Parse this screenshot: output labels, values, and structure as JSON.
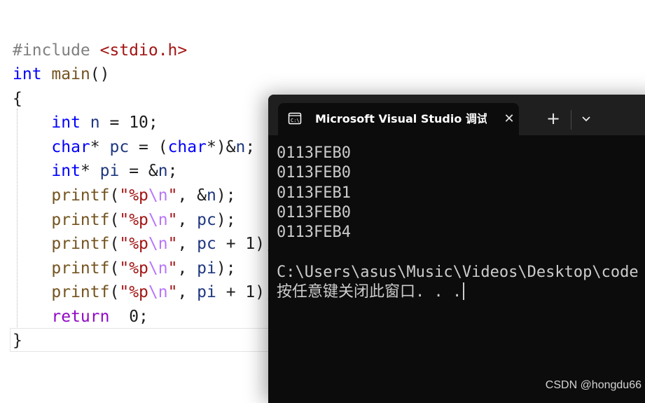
{
  "editor": {
    "lines": [
      {
        "tokens": [
          [
            "pre",
            "#include "
          ],
          [
            "inc",
            "<stdio.h>"
          ]
        ]
      },
      {
        "tokens": [
          [
            "kw",
            "int"
          ],
          [
            "op",
            " "
          ],
          [
            "fn",
            "main"
          ],
          [
            "op",
            "()"
          ]
        ]
      },
      {
        "tokens": [
          [
            "op",
            "{"
          ]
        ]
      },
      {
        "tokens": [
          [
            "op",
            "    "
          ],
          [
            "kw",
            "int"
          ],
          [
            "op",
            " "
          ],
          [
            "var",
            "n"
          ],
          [
            "op",
            " = "
          ],
          [
            "num",
            "10"
          ],
          [
            "op",
            ";"
          ]
        ]
      },
      {
        "tokens": [
          [
            "op",
            "    "
          ],
          [
            "kw",
            "char"
          ],
          [
            "op",
            "* "
          ],
          [
            "var",
            "pc"
          ],
          [
            "op",
            " = ("
          ],
          [
            "kw",
            "char"
          ],
          [
            "op",
            "*)&"
          ],
          [
            "var",
            "n"
          ],
          [
            "op",
            ";"
          ]
        ]
      },
      {
        "tokens": [
          [
            "op",
            "    "
          ],
          [
            "kw",
            "int"
          ],
          [
            "op",
            "* "
          ],
          [
            "var",
            "pi"
          ],
          [
            "op",
            " = &"
          ],
          [
            "var",
            "n"
          ],
          [
            "op",
            ";"
          ]
        ]
      },
      {
        "tokens": [
          [
            "op",
            "    "
          ],
          [
            "fn",
            "printf"
          ],
          [
            "op",
            "("
          ],
          [
            "str",
            "\"%p"
          ],
          [
            "esc",
            "\\n"
          ],
          [
            "str",
            "\""
          ],
          [
            "op",
            ", &"
          ],
          [
            "var",
            "n"
          ],
          [
            "op",
            ");"
          ]
        ]
      },
      {
        "tokens": [
          [
            "op",
            "    "
          ],
          [
            "fn",
            "printf"
          ],
          [
            "op",
            "("
          ],
          [
            "str",
            "\"%p"
          ],
          [
            "esc",
            "\\n"
          ],
          [
            "str",
            "\""
          ],
          [
            "op",
            ", "
          ],
          [
            "var",
            "pc"
          ],
          [
            "op",
            ");"
          ]
        ]
      },
      {
        "tokens": [
          [
            "op",
            "    "
          ],
          [
            "fn",
            "printf"
          ],
          [
            "op",
            "("
          ],
          [
            "str",
            "\"%p"
          ],
          [
            "esc",
            "\\n"
          ],
          [
            "str",
            "\""
          ],
          [
            "op",
            ", "
          ],
          [
            "var",
            "pc"
          ],
          [
            "op",
            " + "
          ],
          [
            "num",
            "1"
          ],
          [
            "op",
            ");"
          ]
        ]
      },
      {
        "tokens": [
          [
            "op",
            "    "
          ],
          [
            "fn",
            "printf"
          ],
          [
            "op",
            "("
          ],
          [
            "str",
            "\"%p"
          ],
          [
            "esc",
            "\\n"
          ],
          [
            "str",
            "\""
          ],
          [
            "op",
            ", "
          ],
          [
            "var",
            "pi"
          ],
          [
            "op",
            ");"
          ]
        ]
      },
      {
        "tokens": [
          [
            "op",
            "    "
          ],
          [
            "fn",
            "printf"
          ],
          [
            "op",
            "("
          ],
          [
            "str",
            "\"%p"
          ],
          [
            "esc",
            "\\n"
          ],
          [
            "str",
            "\""
          ],
          [
            "op",
            ", "
          ],
          [
            "var",
            "pi"
          ],
          [
            "op",
            " + "
          ],
          [
            "num",
            "1"
          ],
          [
            "op",
            ");"
          ]
        ]
      },
      {
        "tokens": [
          [
            "op",
            "    "
          ],
          [
            "ctl",
            "return"
          ],
          [
            "op",
            "  "
          ],
          [
            "num",
            "0"
          ],
          [
            "op",
            ";"
          ]
        ]
      },
      {
        "tokens": [
          [
            "op",
            "}"
          ]
        ]
      }
    ]
  },
  "terminal": {
    "tab_title": "Microsoft Visual Studio 调试控制台",
    "tab_icon": "console-app-icon",
    "close_glyph": "✕",
    "new_tab_glyph": "+",
    "dropdown_icon": "chevron-down-icon",
    "output_lines": [
      "0113FEB0",
      "0113FEB0",
      "0113FEB1",
      "0113FEB0",
      "0113FEB4",
      "",
      "C:\\Users\\asus\\Music\\Videos\\Desktop\\code",
      "按任意键关闭此窗口. . ."
    ]
  },
  "watermark": "CSDN @hongdu66",
  "colors": {
    "terminal_bg": "#0c0c0c",
    "titlebar_bg": "#1f1f1f",
    "console_text": "#cccccc",
    "keyword": "#0000ff",
    "string": "#a31515",
    "function": "#74531f",
    "variable": "#1f377f",
    "control": "#8f08c4"
  }
}
